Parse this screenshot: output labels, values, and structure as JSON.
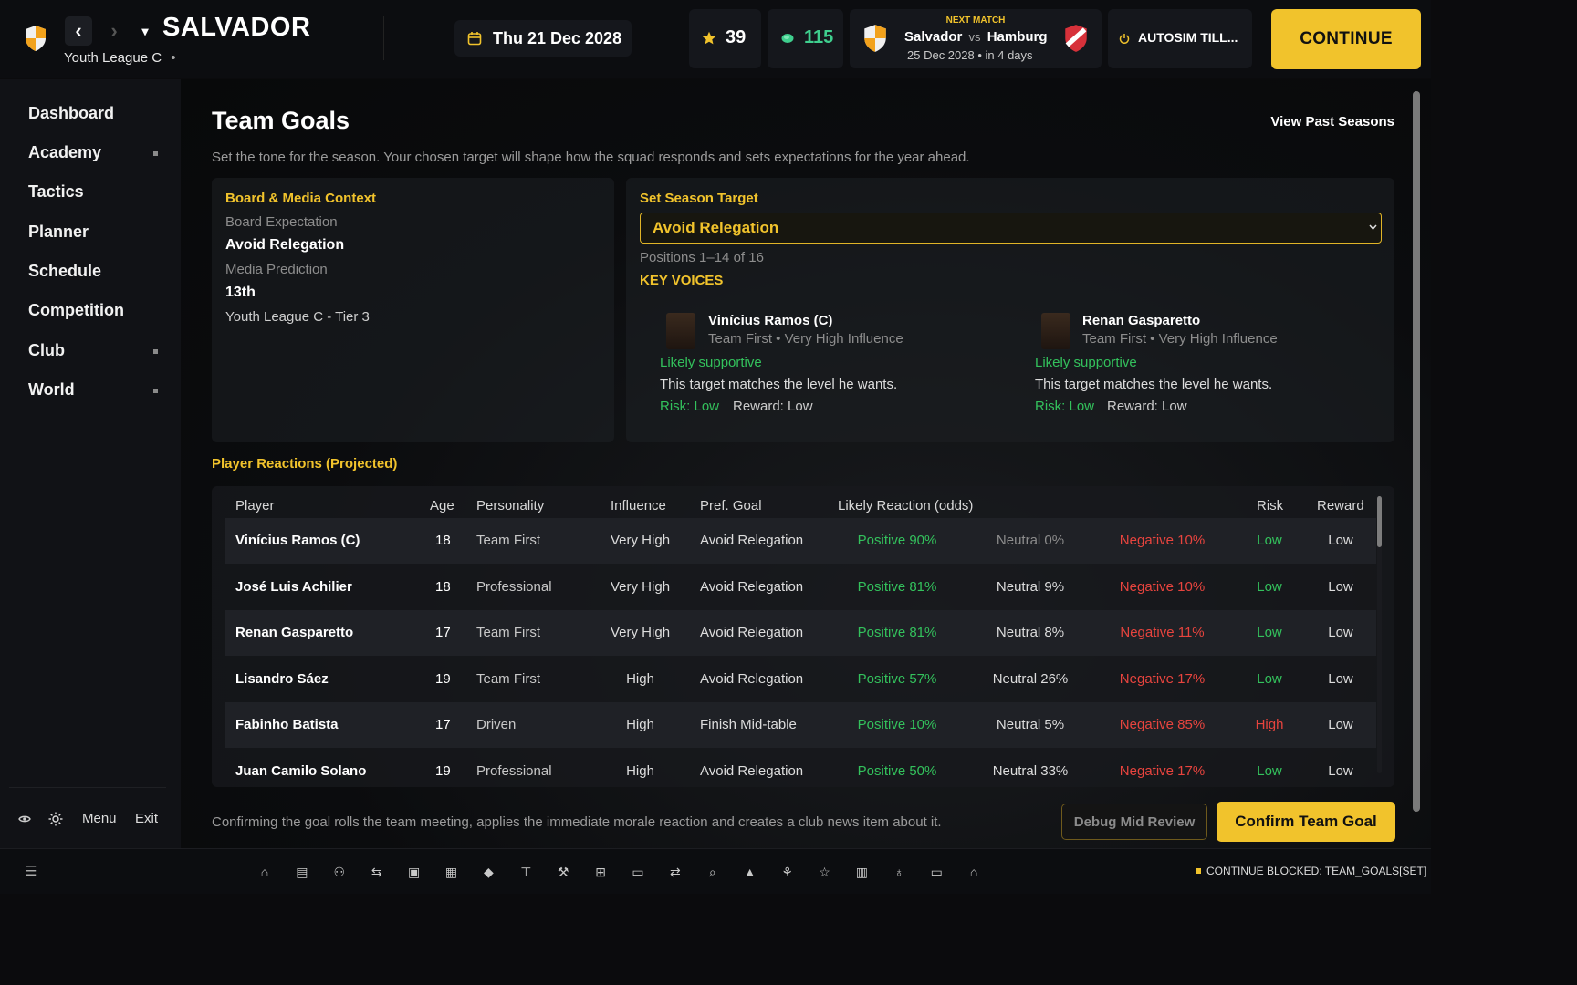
{
  "header": {
    "club_name": "SALVADOR",
    "league": "Youth League C",
    "league_dot": "•",
    "date": "Thu 21 Dec 2028",
    "stars": "39",
    "coins": "115",
    "next_match": {
      "label": "NEXT MATCH",
      "home": "Salvador",
      "vs": "vs",
      "away": "Hamburg",
      "when": "25 Dec 2028 • in 4 days"
    },
    "autosim": "AUTOSIM TILL...",
    "continue": "CONTINUE",
    "back_glyph": "‹",
    "forward_glyph": "›",
    "dropdown_glyph": "▾"
  },
  "sidebar": {
    "items": [
      {
        "label": "Dashboard",
        "sub": false
      },
      {
        "label": "Academy",
        "sub": true
      },
      {
        "label": "Tactics",
        "sub": false
      },
      {
        "label": "Planner",
        "sub": false
      },
      {
        "label": "Schedule",
        "sub": false
      },
      {
        "label": "Competition",
        "sub": false
      },
      {
        "label": "Club",
        "sub": true
      },
      {
        "label": "World",
        "sub": true
      }
    ],
    "menu": "Menu",
    "exit": "Exit"
  },
  "page": {
    "title": "Team Goals",
    "past_seasons": "View Past Seasons",
    "subtitle": "Set the tone for the season. Your chosen target will shape how the squad responds and sets expectations for the year ahead."
  },
  "context": {
    "heading": "Board & Media Context",
    "board_label": "Board Expectation",
    "board_value": "Avoid Relegation",
    "media_label": "Media Prediction",
    "media_value": "13th",
    "league_tier": "Youth League C - Tier 3"
  },
  "target": {
    "heading": "Set Season Target",
    "selected": "Avoid Relegation",
    "positions": "Positions 1–14 of 16",
    "key_voices": "KEY VOICES",
    "voices": [
      {
        "name": "Vinícius Ramos (C)",
        "meta": "Team First • Very High Influence",
        "stance": "Likely supportive",
        "note": "This target matches the level he wants.",
        "risk": "Risk: Low",
        "reward": "Reward: Low"
      },
      {
        "name": "Renan Gasparetto",
        "meta": "Team First • Very High Influence",
        "stance": "Likely supportive",
        "note": "This target matches the level he wants.",
        "risk": "Risk: Low",
        "reward": "Reward: Low"
      }
    ]
  },
  "reactions": {
    "heading": "Player Reactions (Projected)",
    "columns": {
      "player": "Player",
      "age": "Age",
      "personality": "Personality",
      "influence": "Influence",
      "goal": "Pref. Goal",
      "reaction": "Likely Reaction (odds)",
      "risk": "Risk",
      "reward": "Reward"
    },
    "rows": [
      {
        "player": "Vinícius Ramos (C)",
        "age": "18",
        "personality": "Team First",
        "influence": "Very High",
        "goal": "Avoid Relegation",
        "pos": "Positive 90%",
        "neu": "Neutral 0%",
        "neg": "Negative 10%",
        "risk": "Low",
        "reward": "Low"
      },
      {
        "player": "José Luis Achilier",
        "age": "18",
        "personality": "Professional",
        "influence": "Very High",
        "goal": "Avoid Relegation",
        "pos": "Positive 81%",
        "neu": "Neutral 9%",
        "neg": "Negative 10%",
        "risk": "Low",
        "reward": "Low"
      },
      {
        "player": "Renan Gasparetto",
        "age": "17",
        "personality": "Team First",
        "influence": "Very High",
        "goal": "Avoid Relegation",
        "pos": "Positive 81%",
        "neu": "Neutral 8%",
        "neg": "Negative 11%",
        "risk": "Low",
        "reward": "Low"
      },
      {
        "player": "Lisandro Sáez",
        "age": "19",
        "personality": "Team First",
        "influence": "High",
        "goal": "Avoid Relegation",
        "pos": "Positive 57%",
        "neu": "Neutral 26%",
        "neg": "Negative 17%",
        "risk": "Low",
        "reward": "Low"
      },
      {
        "player": "Fabinho Batista",
        "age": "17",
        "personality": "Driven",
        "influence": "High",
        "goal": "Finish Mid-table",
        "pos": "Positive 10%",
        "neu": "Neutral 5%",
        "neg": "Negative 85%",
        "risk": "High",
        "reward": "Low"
      },
      {
        "player": "Juan Camilo Solano",
        "age": "19",
        "personality": "Professional",
        "influence": "High",
        "goal": "Avoid Relegation",
        "pos": "Positive 50%",
        "neu": "Neutral 33%",
        "neg": "Negative 17%",
        "risk": "Low",
        "reward": "Low"
      }
    ]
  },
  "footer": {
    "note": "Confirming the goal rolls the team meeting, applies the immediate morale reaction and creates a club news item about it.",
    "debug": "Debug Mid Review",
    "confirm": "Confirm Team Goal",
    "status": "CONTINUE BLOCKED: TEAM_GOALS[SET]",
    "menu_glyph": "☰"
  },
  "icons": [
    "home-icon",
    "news-icon",
    "squad-icon",
    "transfers-icon",
    "save-icon",
    "calendar-icon",
    "scouting-icon",
    "training-icon",
    "tactics-icon",
    "medical-icon",
    "finance-icon",
    "exchange-icon",
    "search-icon",
    "alert-icon",
    "network-icon",
    "star-icon",
    "stats-icon",
    "award-icon",
    "folder-icon",
    "stadium-icon"
  ],
  "colors": {
    "accent": "#f1c32c",
    "positive": "#33c15c",
    "negative": "#e8443e",
    "coins": "#3fcf8e"
  }
}
